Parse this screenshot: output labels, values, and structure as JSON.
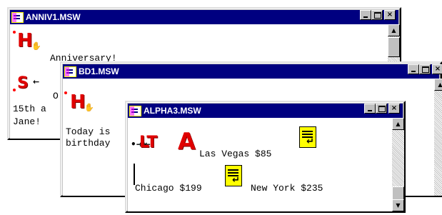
{
  "windows": [
    {
      "title": "ANNIV1.MSW",
      "lines": [
        "Anniversary!",
        "O",
        "15th a",
        "Jane!"
      ],
      "markers": {
        "main": "H",
        "secondary": "S",
        "secondary_arrow": "←"
      }
    },
    {
      "title": "BD1.MSW",
      "lines": [
        "Today is",
        "birthday"
      ],
      "markers": {
        "main": "H"
      }
    },
    {
      "title": "ALPHA3.MSW",
      "markers": {
        "left": "LT",
        "arrows": "•⇥⇤",
        "big": "A"
      },
      "text": {
        "city1": "Las Vegas $85",
        "city2": "Chicago $199",
        "city3": "New York $235"
      }
    }
  ],
  "titlebar_buttons": {
    "minimize": "_",
    "maximize": "□",
    "close": "×"
  },
  "scrollbar": {
    "up": "▲",
    "down": "▼"
  },
  "colors": {
    "title_active": "#000080",
    "marker_red": "#e00000",
    "note_yellow": "#ffff00"
  }
}
